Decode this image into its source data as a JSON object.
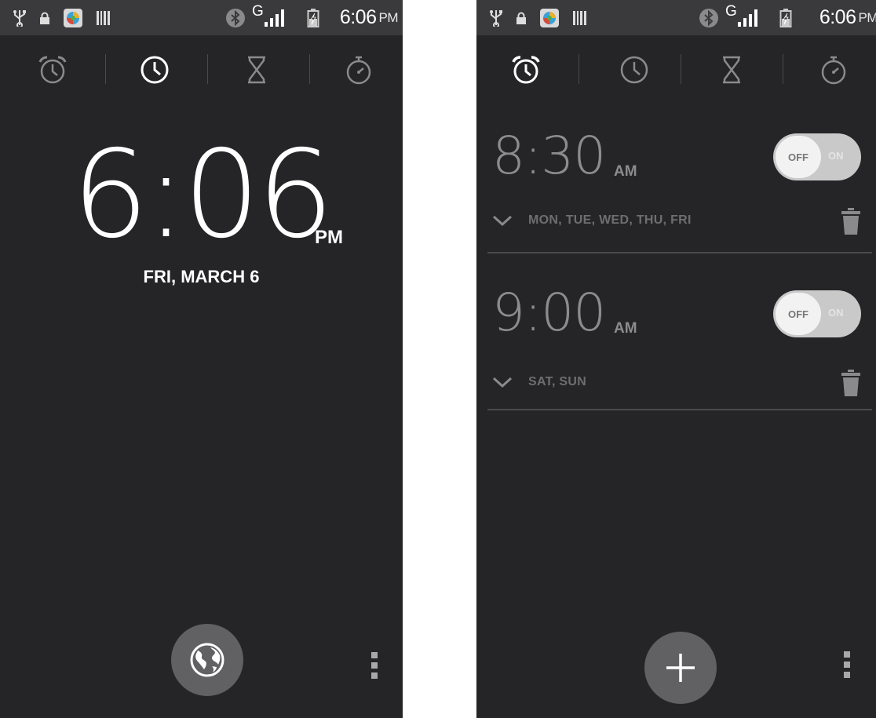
{
  "left_screen": {
    "status_bar": {
      "network": "G",
      "time": "6:06",
      "ampm": "PM"
    },
    "tabs": [
      "alarm-tab",
      "clock-tab",
      "timer-tab",
      "stopwatch-tab"
    ],
    "active_tab": "clock-tab",
    "clock": {
      "time": "6:06",
      "ampm": "PM",
      "date": "FRI, MARCH 6"
    },
    "fab_icon": "globe-icon",
    "overflow_icon": "overflow-menu-icon"
  },
  "right_screen": {
    "status_bar": {
      "network": "G",
      "time": "6:06",
      "ampm": "PM"
    },
    "tabs": [
      "alarm-tab",
      "clock-tab",
      "timer-tab",
      "stopwatch-tab"
    ],
    "active_tab": "alarm-tab",
    "alarms": [
      {
        "time": "8:30",
        "ampm": "AM",
        "toggle_off": "OFF",
        "toggle_on": "ON",
        "days": "MON, TUE, WED, THU, FRI",
        "enabled": false
      },
      {
        "time": "9:00",
        "ampm": "AM",
        "toggle_off": "OFF",
        "toggle_on": "ON",
        "days": "SAT, SUN",
        "enabled": false
      }
    ],
    "fab_icon": "plus-icon",
    "overflow_icon": "overflow-menu-icon"
  },
  "colors": {
    "background": "#252527",
    "statusbar": "#3a3a3c",
    "fab": "#616163",
    "dim_text": "#8c8c8e"
  }
}
